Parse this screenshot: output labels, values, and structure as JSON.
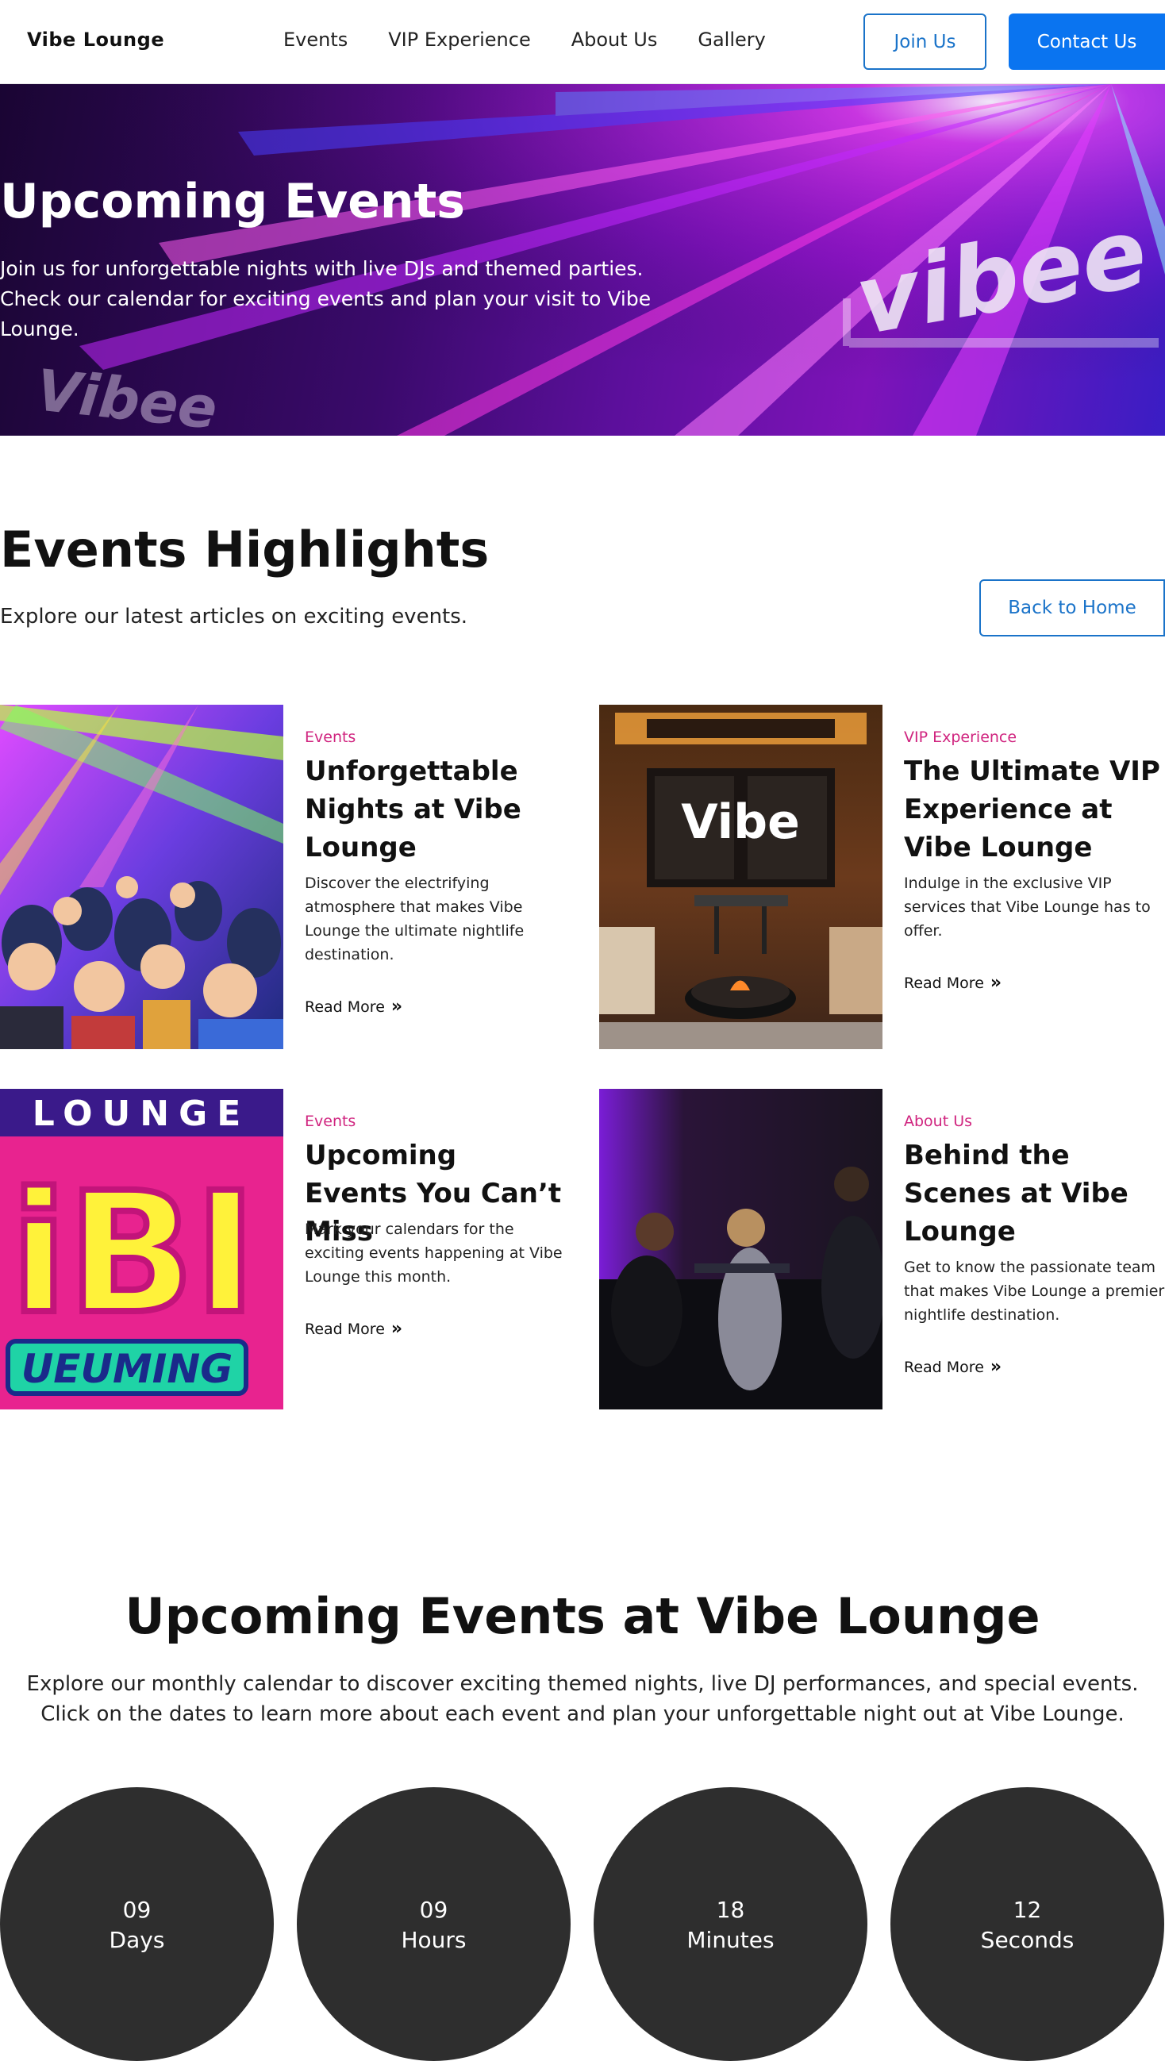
{
  "navbar": {
    "brand": "Vibe Lounge",
    "links": [
      "Events",
      "VIP Experience",
      "About Us",
      "Gallery"
    ],
    "join_label": "Join Us",
    "contact_label": "Contact Us"
  },
  "hero": {
    "title": "Upcoming Events",
    "text": "Join us for unforgettable nights with live DJs and themed parties. Check our calendar for exciting events and plan your visit to Vibe Lounge.",
    "sign_text": "vibee",
    "sign_text_small": "Vibee"
  },
  "highlights": {
    "title": "Events Highlights",
    "subtitle": "Explore our latest articles on exciting events.",
    "back_label": "Back to Home",
    "read_more_label": "Read More",
    "cards": [
      {
        "category": "Events",
        "title": "Unforgettable Nights at Vibe Lounge",
        "description": "Discover the electrifying atmosphere that makes Vibe Lounge the ultimate nightlife destination."
      },
      {
        "category": "VIP Experience",
        "title": "The Ultimate VIP Experience at Vibe Lounge",
        "description": "Indulge in the exclusive VIP services that Vibe Lounge has to offer.",
        "image_text": "Vibe"
      },
      {
        "category": "Events",
        "title": "Upcoming Events You Can’t Miss",
        "description": "Mark your calendars for the exciting events happening at Vibe Lounge this month.",
        "image_text_top": "LOUNGE",
        "image_text_mid": "iBI",
        "image_text_bottom": "UEUMING"
      },
      {
        "category": "About Us",
        "title": "Behind the Scenes at Vibe Lounge",
        "description": "Get to know the passionate team that makes Vibe Lounge a premier nightlife destination."
      }
    ]
  },
  "upcoming": {
    "title": "Upcoming Events at Vibe Lounge",
    "text": "Explore our monthly calendar to discover exciting themed nights, live DJ performances, and special events. Click on the dates to learn more about each event and plan your unforgettable night out at Vibe Lounge.",
    "countdown": [
      {
        "value": "09",
        "label": "Days"
      },
      {
        "value": "09",
        "label": "Hours"
      },
      {
        "value": "18",
        "label": "Minutes"
      },
      {
        "value": "12",
        "label": "Seconds"
      }
    ]
  },
  "colors": {
    "accent": "#0a74f0",
    "outline": "#1a73c9",
    "category": "#d0247f",
    "countdown_bg": "#2e2e2e"
  }
}
